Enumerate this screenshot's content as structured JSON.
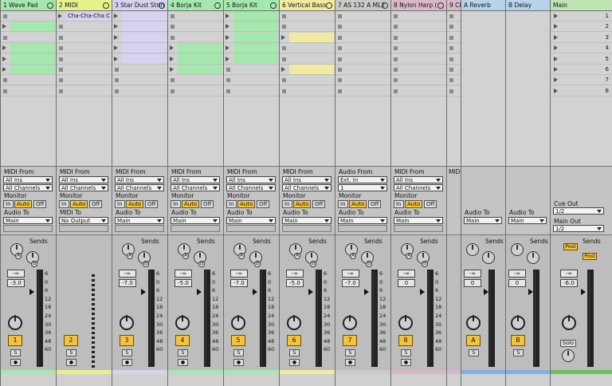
{
  "tracks": [
    {
      "id": "t1",
      "name": "1 Wave Pad",
      "color": "#a4e8ae",
      "clips": [
        1,
        3,
        4,
        5
      ],
      "in_label": "MIDI From",
      "in_src": "All Ins",
      "in_ch": "All Channels",
      "out_label": "Audio To",
      "out": "Main",
      "vol": "-3.0",
      "num": "1",
      "sends": true
    },
    {
      "id": "t2",
      "name": "2 MIDI",
      "color": "#e8f08a",
      "clip_name": "Cha-Cha-Cha C",
      "clipcolor": "#d7d2f0",
      "in_label": "MIDI From",
      "in_src": "All Ins",
      "in_ch": "All Channels",
      "out_label": "MIDI To",
      "out": "No Output",
      "num": "2",
      "sends": false
    },
    {
      "id": "t3",
      "name": "3 Star Dust Strin",
      "color": "#d7d2f0",
      "clips": [
        0,
        1,
        2,
        3,
        4
      ],
      "in_label": "MIDI From",
      "in_src": "All Ins",
      "in_ch": "All Channels",
      "out_label": "Audio To",
      "out": "Main",
      "vol": "-7.0",
      "num": "3",
      "sends": true
    },
    {
      "id": "t4",
      "name": "4 Borja Kit",
      "color": "#a4e8ae",
      "clips": [
        3,
        4,
        5
      ],
      "in_label": "MIDI From",
      "in_src": "All Ins",
      "in_ch": "All Channels",
      "out_label": "Audio To",
      "out": "Main",
      "vol": "-5.0",
      "num": "4",
      "sends": true
    },
    {
      "id": "t5",
      "name": "5 Borja Kit",
      "color": "#a4e8ae",
      "clips": [
        0,
        1,
        2,
        3,
        4
      ],
      "in_label": "MIDI From",
      "in_src": "All Ins",
      "in_ch": "All Channels",
      "out_label": "Audio To",
      "out": "Main",
      "vol": "-7.0",
      "num": "5",
      "sends": true
    },
    {
      "id": "t6",
      "name": "6 Vertical Bass",
      "color": "#f2ea9e",
      "clips": [
        2,
        5
      ],
      "in_label": "MIDI From",
      "in_src": "All Ins",
      "in_ch": "All Channels",
      "out_label": "Audio To",
      "out": "Main",
      "vol": "-5.0",
      "num": "6",
      "sends": true
    },
    {
      "id": "t7",
      "name": "7 AS  132  A  ML2",
      "color": "#c9c9c9",
      "clips": [],
      "in_label": "Audio From",
      "in_src": "Ext. In",
      "in_ch": "1",
      "out_label": "Audio To",
      "out": "Main",
      "vol": "-7.0",
      "num": "7",
      "sends": true
    },
    {
      "id": "t8",
      "name": "8 Nylon Harp (",
      "color": "#d9b8c8",
      "clips": [],
      "in_label": "MIDI From",
      "in_src": "All Ins",
      "in_ch": "All Channels",
      "out_label": "Audio To",
      "out": "Main",
      "vol": "0",
      "num": "8",
      "sends": true
    }
  ],
  "returns": [
    {
      "name": "A Reverb",
      "label": "A",
      "out_label": "Audio To",
      "out": "Main",
      "vol": "0"
    },
    {
      "name": "B Delay",
      "label": "B",
      "out_label": "Audio To",
      "out": "Main",
      "vol": "0"
    }
  ],
  "main": {
    "name": "Main",
    "cue_label": "Cue Out",
    "cue": "1/2",
    "main_label": "Main Out",
    "main_out": "1/2",
    "vol": "-6.0",
    "solo": "Solo",
    "post": "Post",
    "sends_label": "Sends",
    "scene_numbers": [
      "1",
      "2",
      "3",
      "4",
      "5",
      "6",
      "7",
      "8"
    ]
  },
  "labels": {
    "monitor": "Monitor",
    "in": "In",
    "auto": "Auto",
    "off": "Off",
    "sends": "Sends",
    "s": "S",
    "a": "A",
    "b": "B",
    "inf": "-∞"
  },
  "scale": [
    "6",
    "0",
    "6",
    "12",
    "18",
    "24",
    "30",
    "36",
    "48",
    "60"
  ],
  "partial": {
    "name": "9 Ch",
    "in_label": "MIDI",
    "num": "9"
  }
}
